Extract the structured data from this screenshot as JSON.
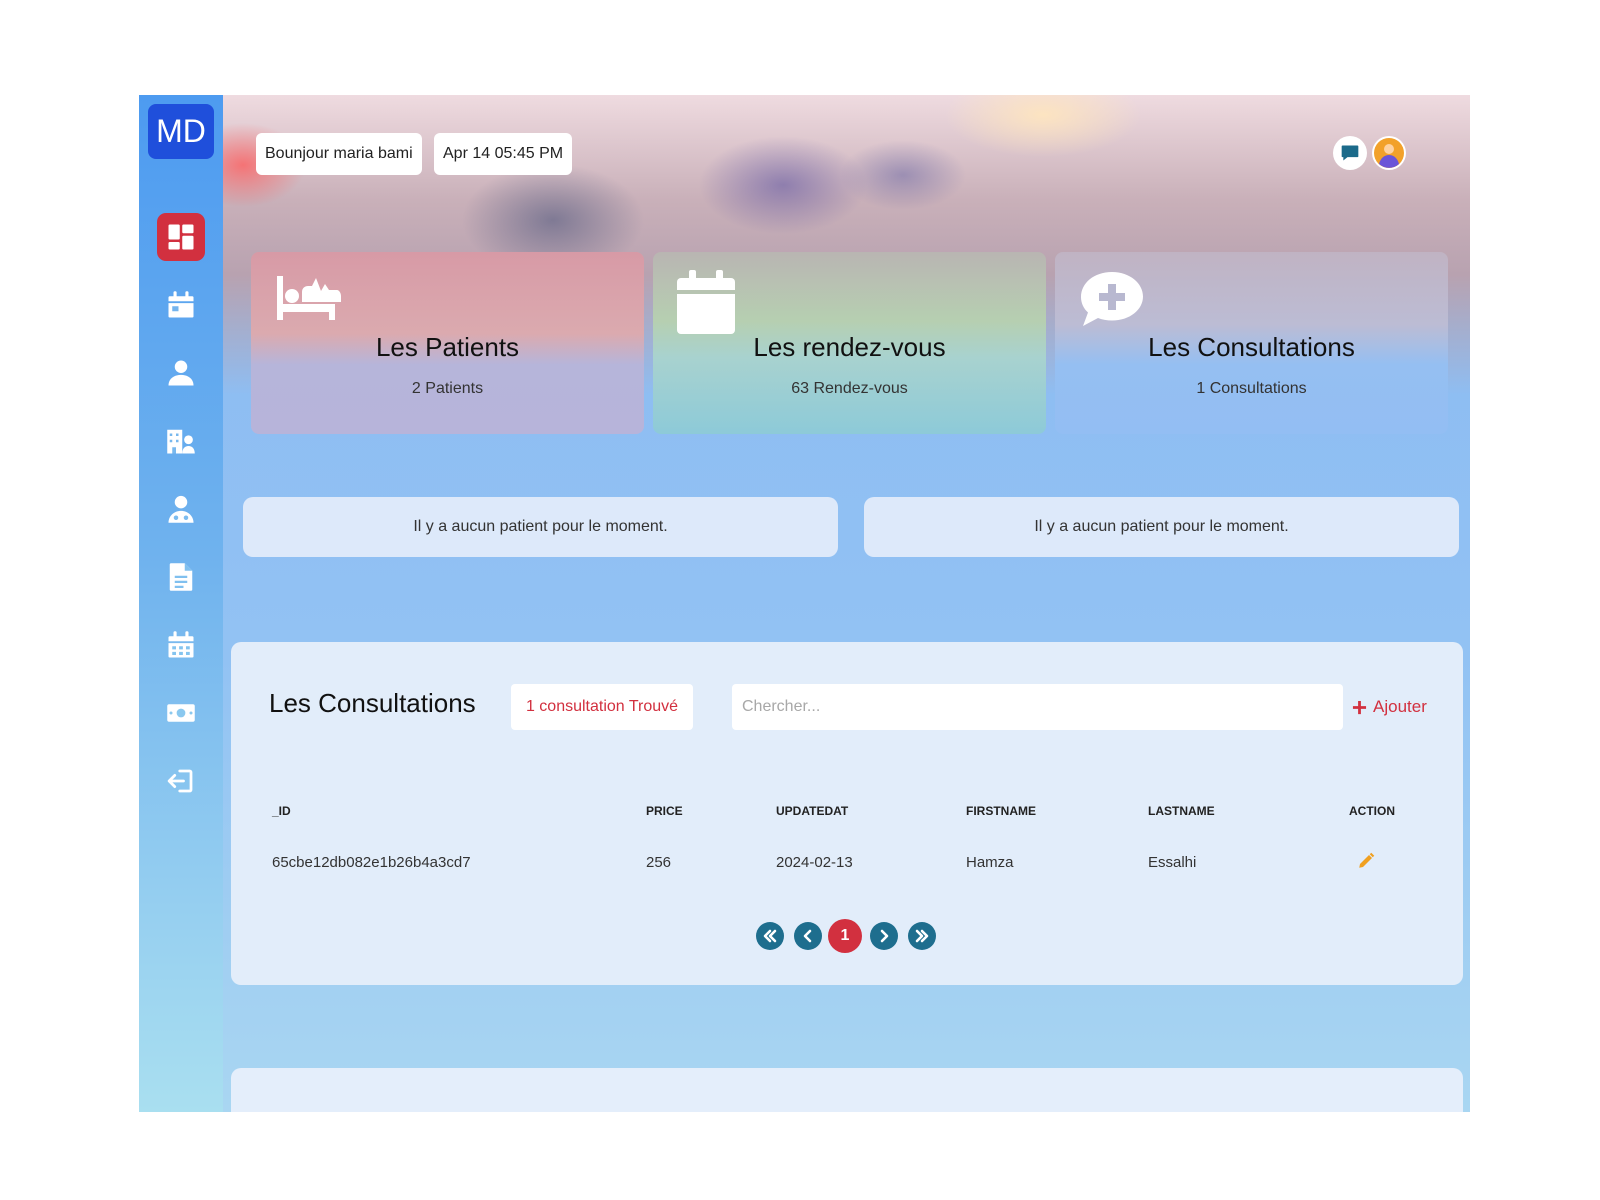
{
  "logo": "MD",
  "header": {
    "greeting": "Bounjour maria bami",
    "datetime": "Apr 14 05:45 PM"
  },
  "nav": {
    "items": [
      "dashboard",
      "appointments",
      "patients",
      "departments",
      "doctors",
      "documents",
      "calendar",
      "payments",
      "logout"
    ],
    "active": "dashboard"
  },
  "stats": [
    {
      "icon": "bed-pulse-icon",
      "title": "Les Patients",
      "count": "2 Patients"
    },
    {
      "icon": "calendar-icon",
      "title": "Les rendez-vous",
      "count": "63 Rendez-vous"
    },
    {
      "icon": "comment-medical-icon",
      "title": "Les Consultations",
      "count": "1 Consultations"
    }
  ],
  "notices": [
    "Il y a aucun patient pour le moment.",
    "Il y a aucun patient pour le moment."
  ],
  "consultations": {
    "title": "Les Consultations",
    "found_label": "1 consultation Trouvé",
    "search_placeholder": "Chercher...",
    "add_label": "Ajouter",
    "columns": [
      "_ID",
      "PRICE",
      "UPDATEDAT",
      "FIRSTNAME",
      "LASTNAME",
      "ACTION"
    ],
    "rows": [
      {
        "id": "65cbe12db082e1b26b4a3cd7",
        "price": "256",
        "updatedat": "2024-02-13",
        "firstname": "Hamza",
        "lastname": "Essalhi"
      }
    ],
    "pagination": {
      "current": "1"
    }
  },
  "colors": {
    "accent_red": "#d2303f",
    "logo_blue": "#1f4fdb",
    "pager_blue": "#1e6e8e",
    "edit_orange": "#f0a020"
  }
}
